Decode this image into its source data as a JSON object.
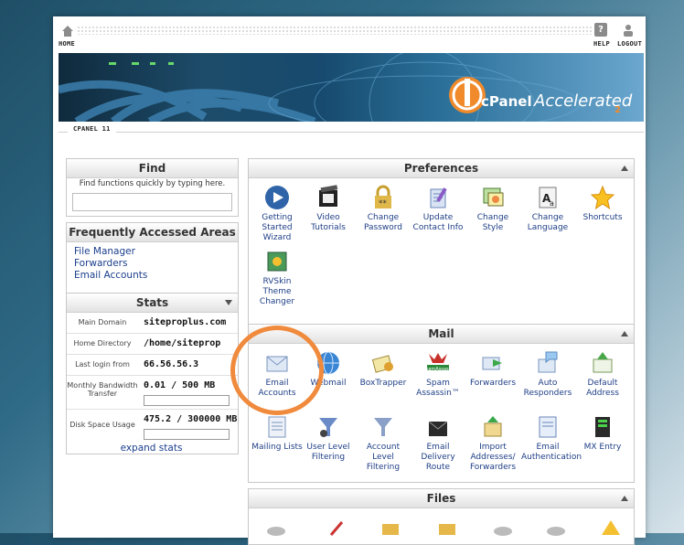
{
  "topbar": {
    "home_label": "HOME",
    "help_label": "HELP",
    "logout_label": "LOGOUT"
  },
  "banner": {
    "brand_logo_text": "cPanel",
    "brand_tagline": "Accelerated",
    "brand_sub": "2"
  },
  "version_label": "CPANEL 11",
  "find": {
    "title": "Find",
    "hint": "Find functions quickly by typing here.",
    "input_value": ""
  },
  "faa": {
    "title": "Frequently Accessed Areas",
    "links": [
      "File Manager",
      "Forwarders",
      "Email Accounts"
    ]
  },
  "stats": {
    "title": "Stats",
    "rows": [
      {
        "label": "Main Domain",
        "value": "siteproplus.com"
      },
      {
        "label": "Home Directory",
        "value": "/home/siteprop"
      },
      {
        "label": "Last login from",
        "value": "66.56.56.3"
      },
      {
        "label": "Monthly Bandwidth Transfer",
        "value": "0.01 / 500 MB"
      },
      {
        "label": "Disk Space Usage",
        "value": "475.2 / 300000 MB"
      }
    ],
    "expand_label": "expand stats"
  },
  "preferences": {
    "title": "Preferences",
    "items": [
      {
        "label": "Getting Started Wizard",
        "icon": "play-icon"
      },
      {
        "label": "Video Tutorials",
        "icon": "film-icon"
      },
      {
        "label": "Change Password",
        "icon": "lock-icon"
      },
      {
        "label": "Update Contact Info",
        "icon": "contact-icon"
      },
      {
        "label": "Change Style",
        "icon": "style-icon"
      },
      {
        "label": "Change Language",
        "icon": "language-icon"
      },
      {
        "label": "Shortcuts",
        "icon": "star-icon"
      },
      {
        "label": "RVSkin Theme Changer",
        "icon": "theme-icon"
      }
    ]
  },
  "mail": {
    "title": "Mail",
    "items": [
      {
        "label": "Email Accounts",
        "icon": "envelope-icon"
      },
      {
        "label": "Webmail",
        "icon": "globe-icon"
      },
      {
        "label": "BoxTrapper",
        "icon": "boxtrapper-icon"
      },
      {
        "label": "Spam Assassin™",
        "icon": "spamassassin-icon"
      },
      {
        "label": "Forwarders",
        "icon": "forward-icon"
      },
      {
        "label": "Auto Responders",
        "icon": "autoresponder-icon"
      },
      {
        "label": "Default Address",
        "icon": "default-address-icon"
      },
      {
        "label": "Mailing Lists",
        "icon": "mailing-list-icon"
      },
      {
        "label": "User Level Filtering",
        "icon": "user-filter-icon"
      },
      {
        "label": "Account Level Filtering",
        "icon": "account-filter-icon"
      },
      {
        "label": "Email Delivery Route",
        "icon": "delivery-route-icon"
      },
      {
        "label": "Import Addresses/ Forwarders",
        "icon": "import-icon"
      },
      {
        "label": "Email Authentication",
        "icon": "authentication-icon"
      },
      {
        "label": "MX Entry",
        "icon": "mx-entry-icon"
      }
    ],
    "spam_badge": "SpamAssassin"
  },
  "files": {
    "title": "Files"
  },
  "colors": {
    "highlight_circle": "#f08a3c",
    "link": "#1f3f86"
  }
}
